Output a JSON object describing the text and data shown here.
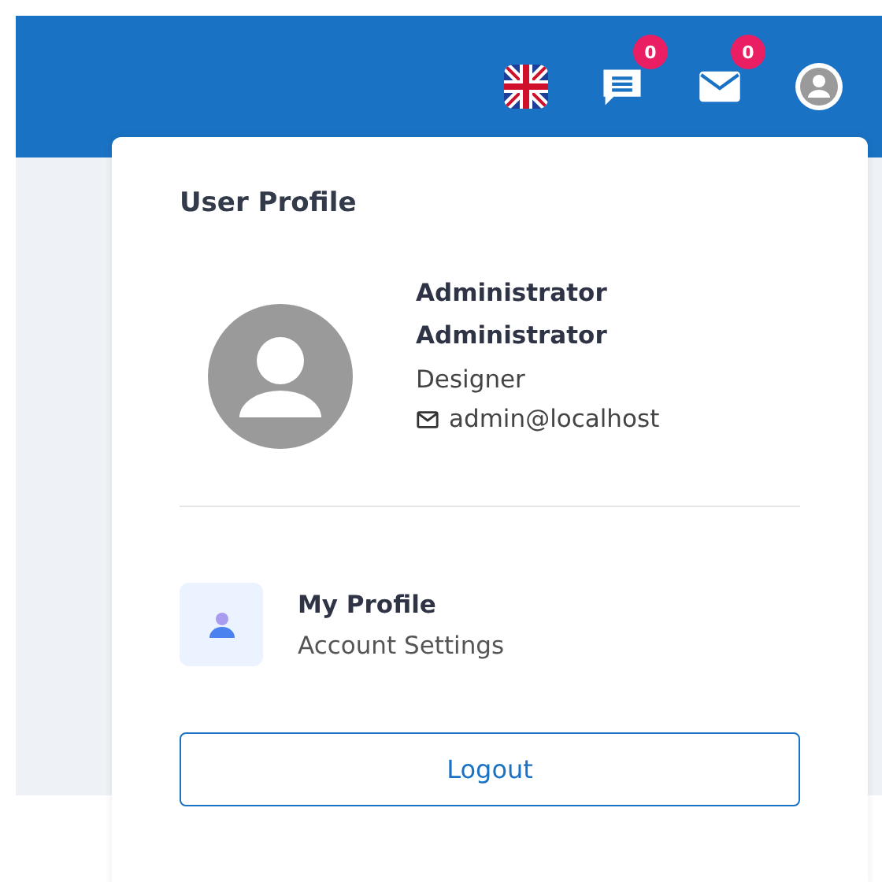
{
  "header": {
    "chat_badge": "0",
    "mail_badge": "0"
  },
  "profile_menu": {
    "title": "User Profile",
    "name_lines": [
      "Administrator",
      "Administrator"
    ],
    "role": "Designer",
    "email": "admin@localhost",
    "items": [
      {
        "title": "My Profile",
        "subtitle": "Account Settings"
      }
    ],
    "logout": "Logout"
  }
}
